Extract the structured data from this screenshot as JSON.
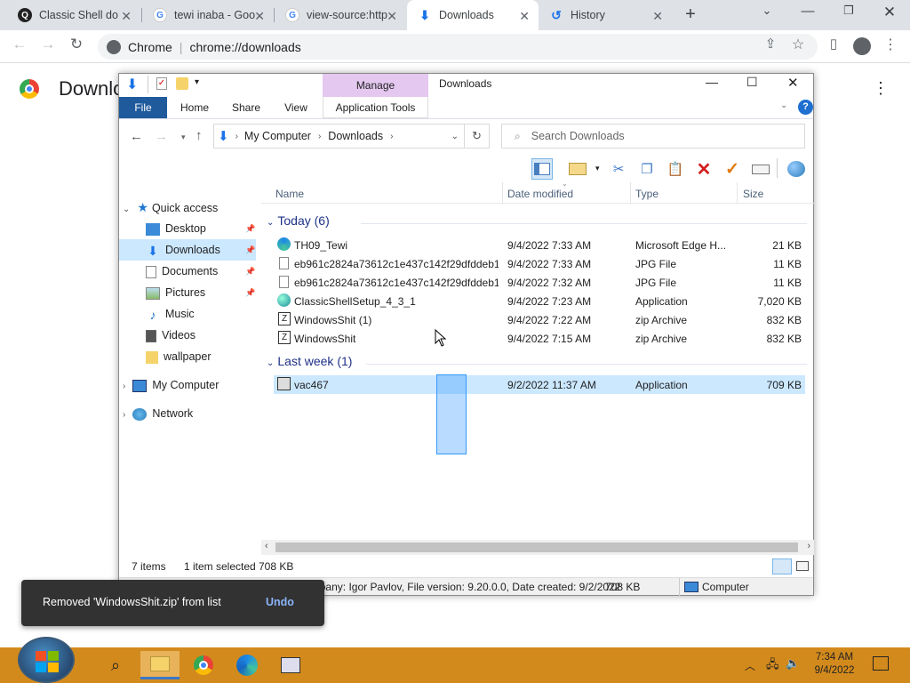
{
  "browser": {
    "tabs": [
      {
        "title": "Classic Shell do",
        "icon": "q-icon"
      },
      {
        "title": "tewi inaba - Goo",
        "icon": "google-icon"
      },
      {
        "title": "view-source:http",
        "icon": "google-icon"
      },
      {
        "title": "Downloads",
        "icon": "download-icon"
      },
      {
        "title": "History",
        "icon": "history-icon"
      }
    ],
    "omnibox": {
      "site": "Chrome",
      "url": "chrome://downloads"
    }
  },
  "downloads_page": {
    "title": "Downloads"
  },
  "toast": {
    "message": "Removed 'WindowsShit.zip' from list",
    "undo": "Undo"
  },
  "explorer": {
    "window_title": "Downloads",
    "ribbon": {
      "context_group": "Manage",
      "tabs": [
        "File",
        "Home",
        "Share",
        "View",
        "Application Tools"
      ]
    },
    "address": [
      "My Computer",
      "Downloads"
    ],
    "search_placeholder": "Search Downloads",
    "columns": [
      "Name",
      "Date modified",
      "Type",
      "Size"
    ],
    "groups": [
      {
        "label": "Today (6)",
        "files": [
          {
            "name": "TH09_Tewi",
            "date": "9/4/2022 7:33 AM",
            "type": "Microsoft Edge H...",
            "size": "21 KB",
            "icon": "edge-icon"
          },
          {
            "name": "eb961c2824a73612c1e437c142f29dfddeb1...",
            "date": "9/4/2022 7:33 AM",
            "type": "JPG File",
            "size": "11 KB",
            "icon": "file-icon"
          },
          {
            "name": "eb961c2824a73612c1e437c142f29dfddeb1...",
            "date": "9/4/2022 7:32 AM",
            "type": "JPG File",
            "size": "11 KB",
            "icon": "file-icon"
          },
          {
            "name": "ClassicShellSetup_4_3_1",
            "date": "9/4/2022 7:23 AM",
            "type": "Application",
            "size": "7,020 KB",
            "icon": "shell-icon"
          },
          {
            "name": "WindowsShit (1)",
            "date": "9/4/2022 7:22 AM",
            "type": "zip Archive",
            "size": "832 KB",
            "icon": "zip-icon"
          },
          {
            "name": "WindowsShit",
            "date": "9/4/2022 7:15 AM",
            "type": "zip Archive",
            "size": "832 KB",
            "icon": "zip-icon"
          }
        ]
      },
      {
        "label": "Last week (1)",
        "files": [
          {
            "name": "vac467",
            "date": "9/2/2022 11:37 AM",
            "type": "Application",
            "size": "709 KB",
            "icon": "setup-icon"
          }
        ]
      }
    ],
    "nav": {
      "quick_access": "Quick access",
      "items": [
        "Desktop",
        "Downloads",
        "Documents",
        "Pictures",
        "Music",
        "Videos",
        "wallpaper"
      ],
      "my_computer": "My Computer",
      "network": "Network"
    },
    "status": {
      "count": "7 items",
      "selected": "1 item selected",
      "size": "708 KB"
    },
    "details_bar": {
      "description": "File description: 7z Setup SFX small, Company: Igor Pavlov, File version: 9.20.0.0, Date created: 9/2/2022",
      "size": "708 KB",
      "location": "Computer"
    }
  },
  "taskbar": {
    "time": "7:34 AM",
    "date": "9/4/2022"
  },
  "colors": {
    "tabstrip": "#dee1e6",
    "ribbon_manage": "#e4c8f0",
    "selection": "#cce8ff",
    "taskbar": "#d38a1c",
    "chrome_blue": "#1a73e8"
  }
}
